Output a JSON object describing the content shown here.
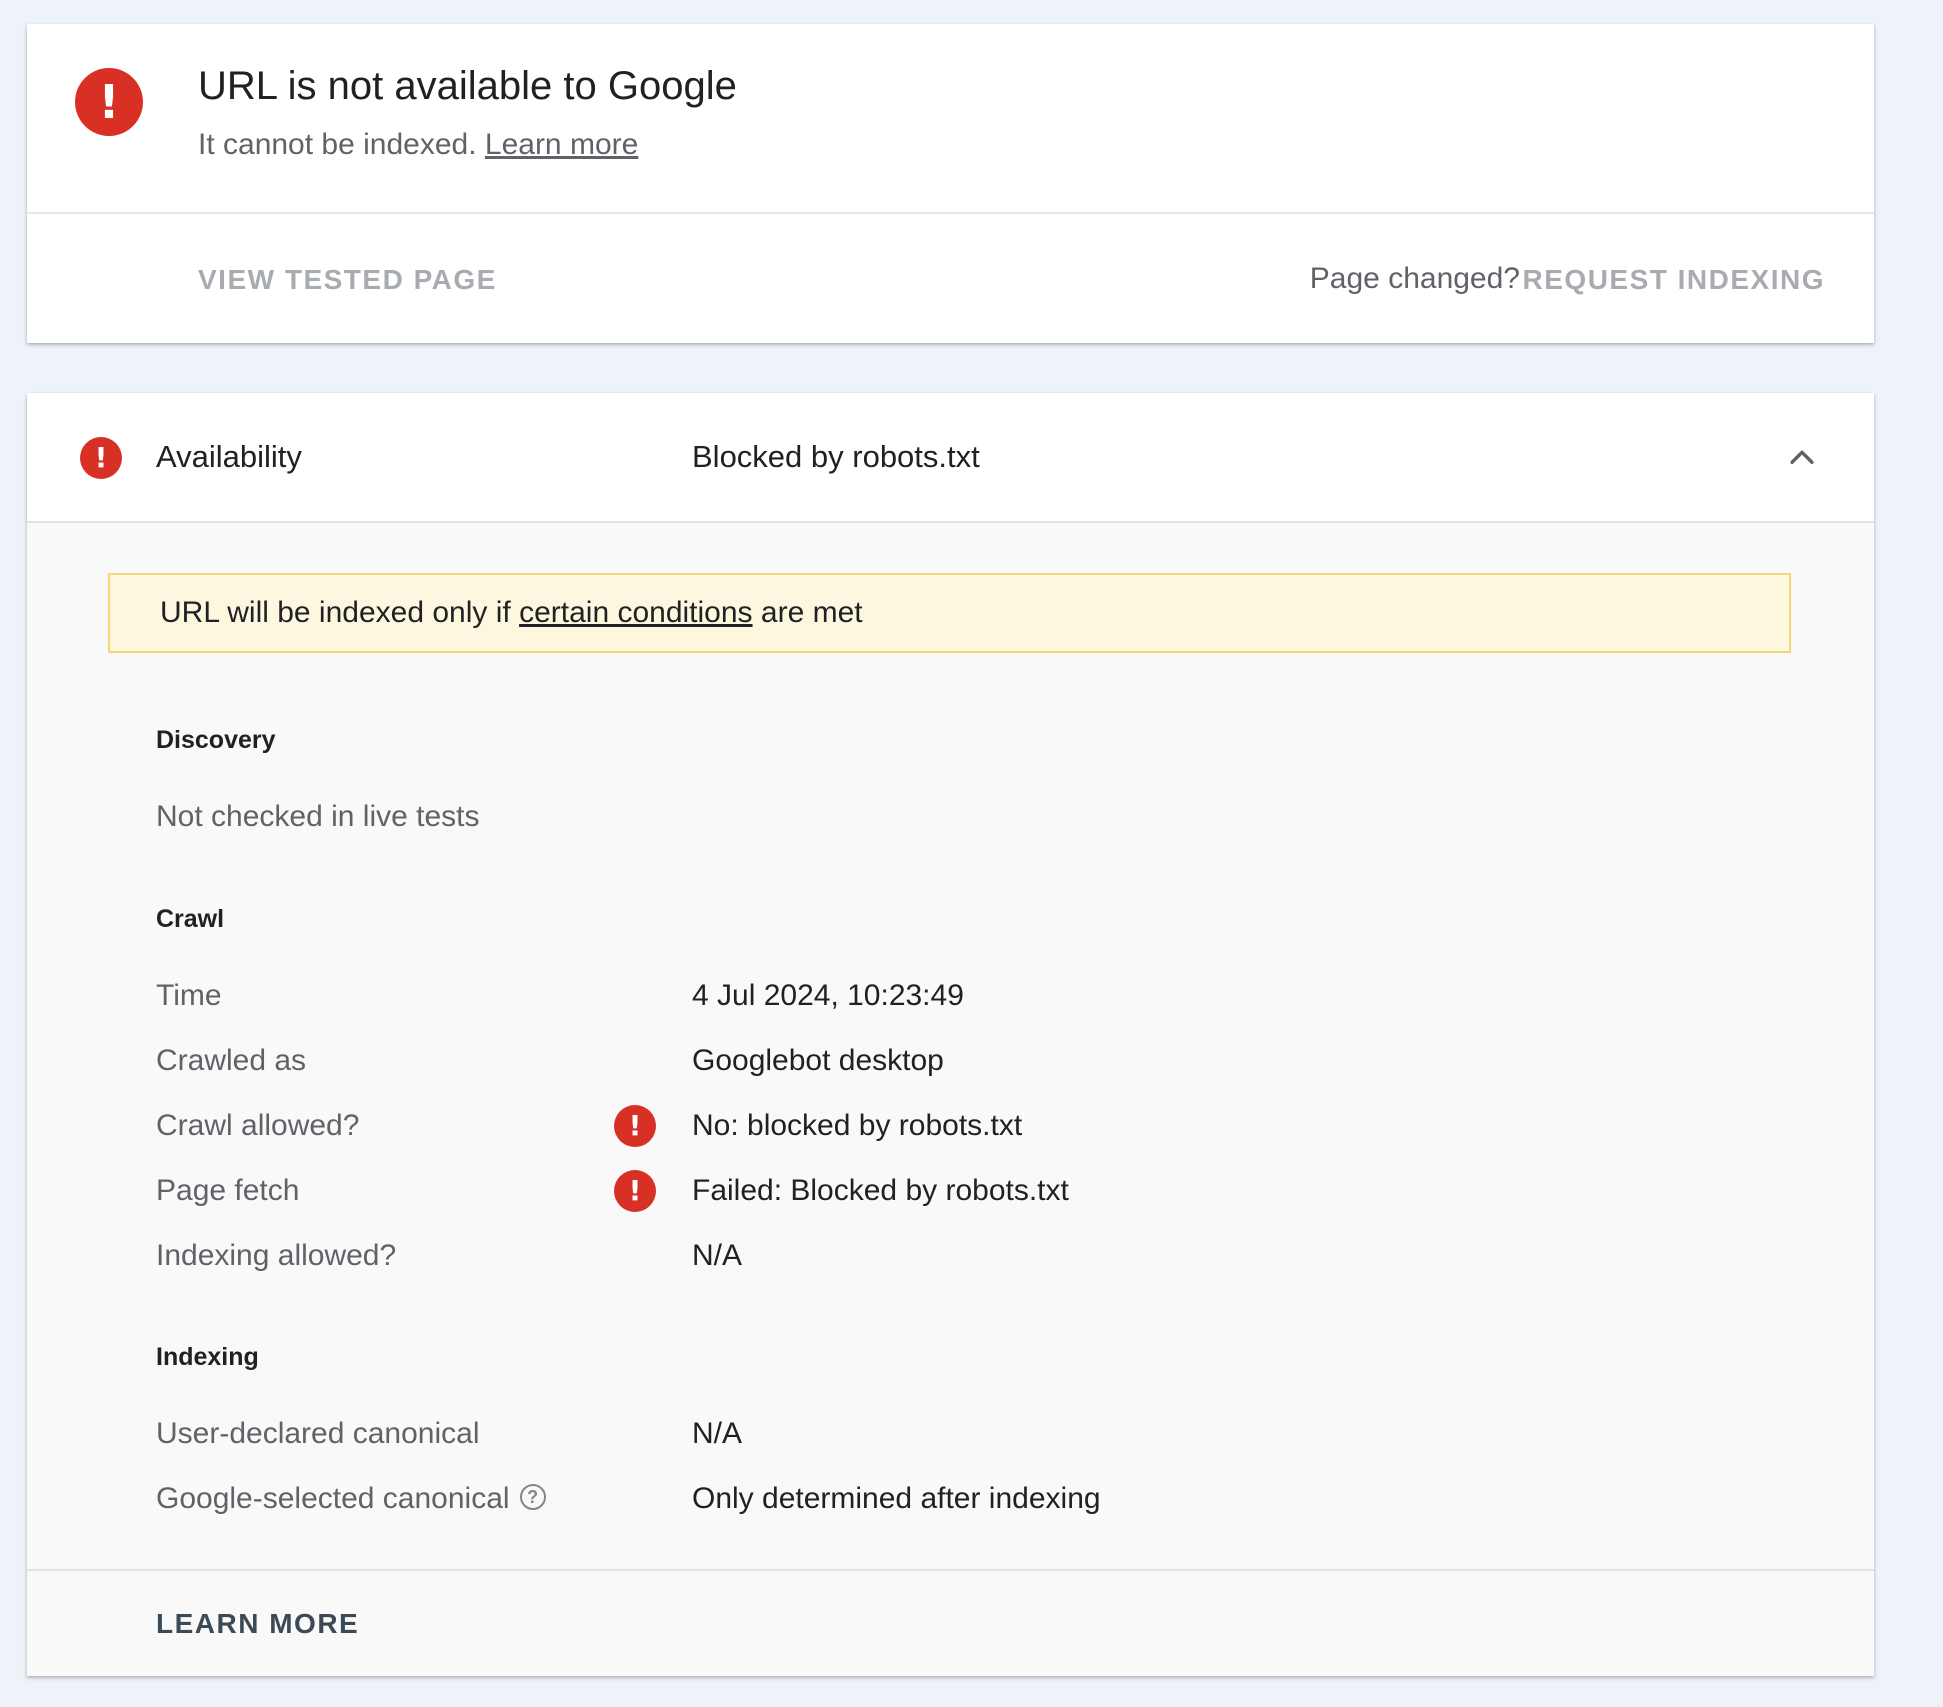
{
  "status_card": {
    "icon": "error-icon",
    "title": "URL is not available to Google",
    "subtitle": "It cannot be indexed.",
    "learn_more_link": "Learn more",
    "view_tested_page": "VIEW TESTED PAGE",
    "page_changed": "Page changed?",
    "request_indexing": "REQUEST INDEXING"
  },
  "availability": {
    "label": "Availability",
    "value": "Blocked by robots.txt",
    "icon": "error-icon",
    "toggle_icon": "chevron-up-icon"
  },
  "warning": {
    "prefix": "URL will be indexed only if",
    "link": "certain conditions",
    "suffix": "are met",
    "background_color": "#fef7e0",
    "border_color": "#f5d77a"
  },
  "discovery": {
    "title": "Discovery",
    "note": "Not checked in live tests"
  },
  "crawl": {
    "title": "Crawl",
    "rows": [
      {
        "label": "Time",
        "value": "4 Jul 2024, 10:23:49"
      },
      {
        "label": "Crawled as",
        "value": "Googlebot desktop"
      },
      {
        "label": "Crawl allowed?",
        "value": "No: blocked by robots.txt",
        "icon": "error-icon"
      },
      {
        "label": "Page fetch",
        "value": "Failed: Blocked by robots.txt",
        "icon": "error-icon"
      },
      {
        "label": "Indexing allowed?",
        "value": "N/A"
      }
    ]
  },
  "indexing": {
    "title": "Indexing",
    "rows": [
      {
        "label": "User-declared canonical",
        "value": "N/A"
      },
      {
        "label": "Google-selected canonical",
        "value": "Only determined after indexing",
        "help_icon": "help-circle-icon",
        "help_glyph": "?"
      }
    ]
  },
  "footer": {
    "learn_more": "LEARN MORE"
  },
  "colors": {
    "error": "#d93025",
    "background": "#eef2f9"
  }
}
